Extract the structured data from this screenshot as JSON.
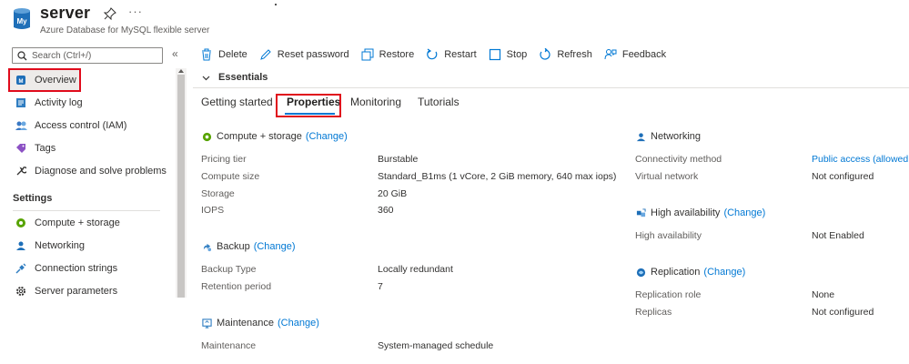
{
  "header": {
    "title": "server",
    "subtitle": "Azure Database for MySQL flexible server",
    "more": "···",
    "app_icon_text": "My"
  },
  "sidebar": {
    "search_placeholder": "Search (Ctrl+/)",
    "collapse": "«",
    "items": [
      {
        "label": "Overview",
        "icon": "mysql-icon"
      },
      {
        "label": "Activity log",
        "icon": "activity-log-icon"
      },
      {
        "label": "Access control (IAM)",
        "icon": "people-icon"
      },
      {
        "label": "Tags",
        "icon": "tag-icon"
      },
      {
        "label": "Diagnose and solve problems",
        "icon": "wrench-icon"
      }
    ],
    "settings_label": "Settings",
    "settings_items": [
      {
        "label": "Compute + storage",
        "icon": "compute-icon"
      },
      {
        "label": "Networking",
        "icon": "networking-icon"
      },
      {
        "label": "Connection strings",
        "icon": "plug-icon"
      },
      {
        "label": "Server parameters",
        "icon": "gear-icon"
      }
    ]
  },
  "toolbar": {
    "delete": "Delete",
    "reset_password": "Reset password",
    "restore": "Restore",
    "restart": "Restart",
    "stop": "Stop",
    "refresh": "Refresh",
    "feedback": "Feedback"
  },
  "essentials_label": "Essentials",
  "tabs": [
    "Getting started",
    "Properties",
    "Monitoring",
    "Tutorials"
  ],
  "active_tab": "Properties",
  "change_label": "(Change)",
  "compute": {
    "title": "Compute + storage",
    "rows": [
      {
        "label": "Pricing tier",
        "value": "Burstable"
      },
      {
        "label": "Compute size",
        "value": "Standard_B1ms (1 vCore, 2 GiB memory, 640 max iops)"
      },
      {
        "label": "Storage",
        "value": "20 GiB"
      },
      {
        "label": "IOPS",
        "value": "360"
      }
    ]
  },
  "backup": {
    "title": "Backup",
    "rows": [
      {
        "label": "Backup Type",
        "value": "Locally redundant"
      },
      {
        "label": "Retention period",
        "value": "7"
      }
    ]
  },
  "maintenance": {
    "title": "Maintenance",
    "rows": [
      {
        "label": "Maintenance",
        "value": "System-managed schedule"
      }
    ]
  },
  "networking": {
    "title": "Networking",
    "rows": [
      {
        "label": "Connectivity method",
        "value": "Public access (allowed IP"
      },
      {
        "label": "Virtual network",
        "value": "Not configured"
      }
    ]
  },
  "high_availability": {
    "title": "High availability",
    "rows": [
      {
        "label": "High availability",
        "value": "Not Enabled"
      }
    ]
  },
  "replication": {
    "title": "Replication",
    "rows": [
      {
        "label": "Replication role",
        "value": "None"
      },
      {
        "label": "Replicas",
        "value": "Not configured"
      }
    ]
  },
  "colors": {
    "accent": "#0078d4",
    "highlight_box": "#e00b1c",
    "active_nav": "#edebe9"
  }
}
